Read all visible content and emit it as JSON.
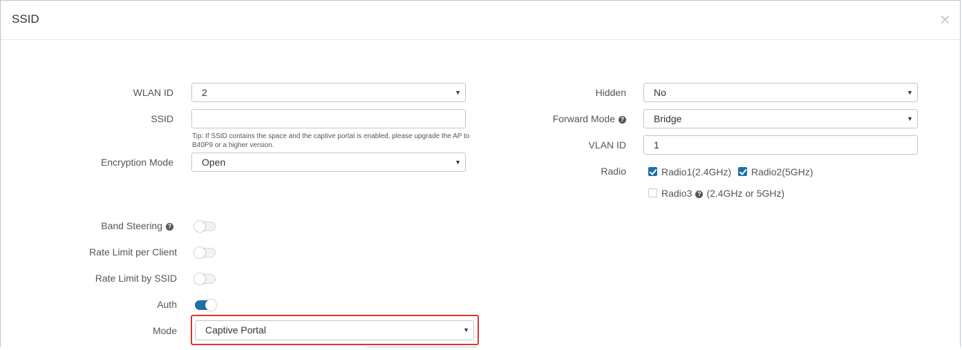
{
  "modal": {
    "title": "SSID",
    "close_glyph": "×"
  },
  "left": {
    "wlan_id": {
      "label": "WLAN ID",
      "value": "2"
    },
    "ssid": {
      "label": "SSID",
      "value": "",
      "tip": "Tip: If SSID contains the space and the captive portal is enabled, please upgrade the AP to B40P9 or a higher version."
    },
    "encryption_mode": {
      "label": "Encryption Mode",
      "value": "Open"
    },
    "band_steering": {
      "label": "Band Steering",
      "enabled": false
    },
    "rate_limit_client": {
      "label": "Rate Limit per Client",
      "enabled": false
    },
    "rate_limit_ssid": {
      "label": "Rate Limit by SSID",
      "enabled": false
    },
    "auth": {
      "label": "Auth",
      "enabled": true
    },
    "mode": {
      "label": "Mode",
      "value": "Captive Portal"
    }
  },
  "right": {
    "hidden": {
      "label": "Hidden",
      "value": "No"
    },
    "forward_mode": {
      "label": "Forward Mode",
      "value": "Bridge"
    },
    "vlan_id": {
      "label": "VLAN ID",
      "value": "1"
    },
    "radio": {
      "label": "Radio",
      "options": [
        {
          "label": "Radio1(2.4GHz)",
          "checked": true
        },
        {
          "label": "Radio2(5GHz)",
          "checked": true
        },
        {
          "label": "Radio3",
          "suffix": "(2.4GHz or 5GHz)",
          "checked": false
        }
      ]
    }
  },
  "icons": {
    "help": "?",
    "caret": "▼"
  },
  "colors": {
    "accent": "#1f6fa8",
    "highlight": "#e0312b"
  }
}
